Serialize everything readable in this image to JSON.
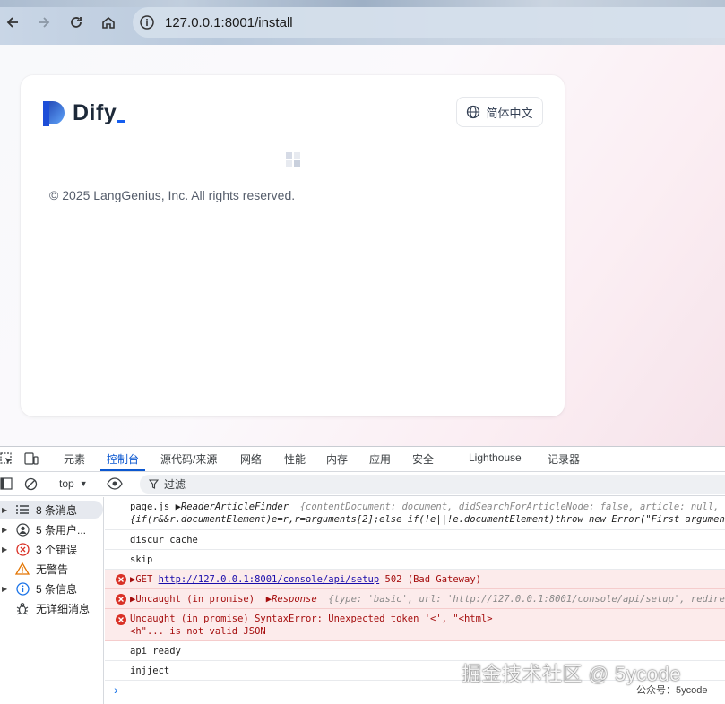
{
  "browser": {
    "url": "127.0.0.1:8001/install"
  },
  "page": {
    "logo_text": "Dify",
    "language_button": "简体中文",
    "copyright": "© 2025 LangGenius, Inc. All rights reserved."
  },
  "devtools": {
    "tabs": [
      "元素",
      "控制台",
      "源代码/来源",
      "网络",
      "性能",
      "内存",
      "应用",
      "安全",
      "Lighthouse",
      "记录器"
    ],
    "active_tab": "控制台",
    "context_select": "top",
    "filter_placeholder": "过滤",
    "sidebar": [
      {
        "label": "8 条消息",
        "icon": "list-icon"
      },
      {
        "label": "5 条用户...",
        "icon": "user-icon"
      },
      {
        "label": "3 个错误",
        "icon": "error-icon"
      },
      {
        "label": "无警告",
        "icon": "warning-icon"
      },
      {
        "label": "5 条信息",
        "icon": "info-icon"
      },
      {
        "label": "无详细消息",
        "icon": "bug-icon"
      }
    ],
    "console": {
      "row1_a": "page.js",
      "row1_b": "ReaderArticleFinder",
      "row1_c": "{contentDocument: document, didSearchForArticleNode: false, article: null, didS",
      "row1_line2": "{if(r&&r.documentElement)e=r,r=arguments[2];else if(!e||!e.documentElement)throw new Error(\"First argument to R",
      "row2": "discur_cache",
      "row3": "skip",
      "row4_method": "GET",
      "row4_url": "http://127.0.0.1:8001/console/api/setup",
      "row4_status": "502 (Bad Gateway)",
      "row5_a": "Uncaught (in promise)",
      "row5_b": "Response",
      "row5_c": "{type: 'basic', url: 'http://127.0.0.1:8001/console/api/setup', redirected",
      "row6_line1": "Uncaught (in promise) SyntaxError: Unexpected token '<', \"<html>",
      "row6_line2": "<h\"... is not valid JSON",
      "row7": "api ready",
      "row8": "injject"
    }
  },
  "watermark": {
    "main": "掘金技术社区 @ 5ycode",
    "sub": "公众号：5ycode"
  }
}
